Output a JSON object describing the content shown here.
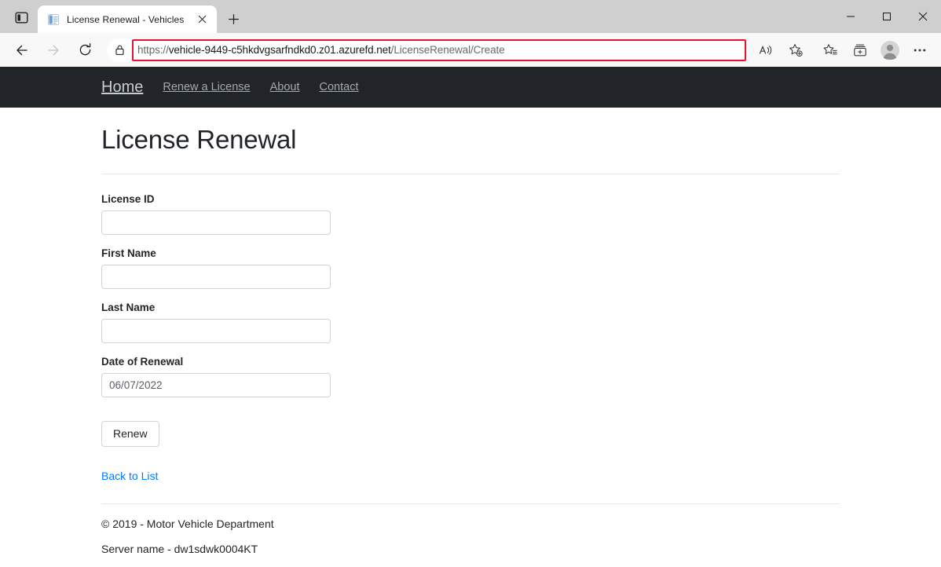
{
  "browser": {
    "tab": {
      "title": "License Renewal - Vehicles",
      "favicon_name": "document-favicon",
      "close_label": "×"
    },
    "new_tab_label": "+",
    "window_controls": {
      "minimize": "–",
      "maximize": "☐",
      "close": "✕"
    },
    "address_bar": {
      "scheme": "https://",
      "host": "vehicle-9449-c5hkdvgsarfndkd0.z01.azurefd.net",
      "path": "/LicenseRenewal/Create",
      "full_url": "https://vehicle-9449-c5hkdvgsarfndkd0.z01.azurefd.net/LicenseRenewal/Create",
      "highlight_color": "#e8112d",
      "lock_icon": "lock-icon"
    },
    "nav_buttons": [
      {
        "name": "back-button",
        "icon": "arrow-left-icon"
      },
      {
        "name": "forward-button",
        "icon": "arrow-right-icon"
      },
      {
        "name": "refresh-button",
        "icon": "reload-icon"
      }
    ],
    "toolbar_icons": [
      {
        "name": "read-aloud-button",
        "icon": "read-aloud-icon"
      },
      {
        "name": "add-favorite-button",
        "icon": "star-plus-icon"
      },
      {
        "name": "favorites-button",
        "icon": "favorites-list-icon"
      },
      {
        "name": "collections-button",
        "icon": "collections-icon"
      },
      {
        "name": "profile-button",
        "icon": "avatar-icon"
      },
      {
        "name": "settings-more-button",
        "icon": "ellipsis-icon"
      }
    ],
    "tab_actions_icon": "tab-actions-icon"
  },
  "page": {
    "navbar": {
      "brand": "Home",
      "links": [
        {
          "label": "Renew a License"
        },
        {
          "label": "About"
        },
        {
          "label": "Contact"
        }
      ]
    },
    "title": "License Renewal",
    "form": {
      "fields": [
        {
          "label": "License ID",
          "value": "",
          "placeholder": ""
        },
        {
          "label": "First Name",
          "value": "",
          "placeholder": ""
        },
        {
          "label": "Last Name",
          "value": "",
          "placeholder": ""
        },
        {
          "label": "Date of Renewal",
          "value": "06/07/2022",
          "placeholder": ""
        }
      ],
      "submit_label": "Renew",
      "back_link_label": "Back to List"
    },
    "footer": {
      "copyright": "© 2019 - Motor Vehicle Department",
      "server": "Server name - dw1sdwk0004KT"
    },
    "colors": {
      "navbar_bg": "#212529",
      "link_blue": "#007bff",
      "border": "#ced4da"
    }
  }
}
